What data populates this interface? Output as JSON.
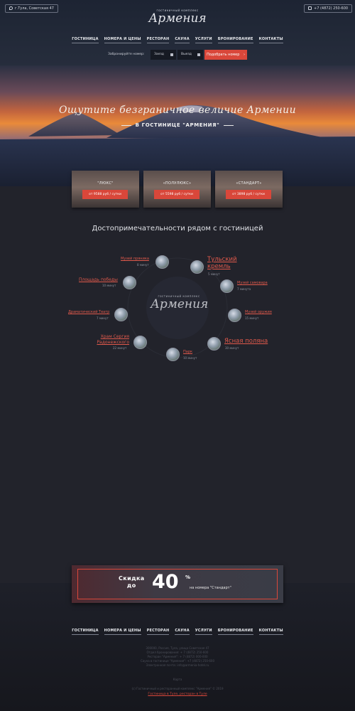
{
  "header": {
    "address": "г.Тула, Советская 47",
    "phone": "+7 (4872) 250-600",
    "logo_sub": "гостиничный комплекс",
    "logo_main": "Армения"
  },
  "nav": {
    "items": [
      "ГОСТИНИЦА",
      "НОМЕРА И ЦЕНЫ",
      "РЕСТОРАН",
      "САУНА",
      "УСЛУГИ",
      "БРОНИРОВАНИЕ",
      "КОНТАКТЫ"
    ]
  },
  "booking": {
    "label": "Забронируйте номер:",
    "checkin": "Заезд",
    "checkout": "Выезд",
    "button": "Подобрать номер"
  },
  "hero": {
    "title": "Ощутите безграничное величие Армении",
    "subtitle": "В ГОСТИНИЦЕ \"АРМЕНИЯ\""
  },
  "rooms": [
    {
      "title": "\"ЛЮКС\"",
      "price": "от 9588 руб / сутки"
    },
    {
      "title": "«ПОЛУЛЮКС»",
      "price": "от 5598 руб / сутки"
    },
    {
      "title": "«СТАНДАРТ»",
      "price": "от 3898 руб / сутки"
    }
  ],
  "attractions": {
    "title": "Достопримечательности рядом с гостиницей",
    "items": [
      {
        "name": "Музей пряника",
        "time": "8 минут"
      },
      {
        "name": "Тульский кремль",
        "time": "5 минут"
      },
      {
        "name": "Площадь победы",
        "time": "10 минут"
      },
      {
        "name": "Музей самовара",
        "time": "7 минута"
      },
      {
        "name": "Драматический Театр",
        "time": "7 минут"
      },
      {
        "name": "Музей оружия",
        "time": "15 минут"
      },
      {
        "name": "Храм Сергия Радонежского",
        "time": "22 минут"
      },
      {
        "name": "Ясная поляна",
        "time": "30 минут"
      },
      {
        "name": "Парк",
        "time": "10 минут"
      }
    ]
  },
  "promo": {
    "line1": "Скидка",
    "line2": "до",
    "number": "40",
    "percent": "%",
    "rest": "на номера \"Стандарт\""
  },
  "footer": {
    "lines": [
      "300000, Россия, Тула, улица Советская 47",
      "Отдел бронирования: + 7 (4872) 250-600",
      "Ресторан \"Армения\": + 7 (4872) 000-000",
      "Сауна в гостинице \"Армения\": +7 (4872) 250-600",
      "Электронная почта: info@armenia-hotel.ru"
    ],
    "map": "Карта",
    "copyright": "(c) Гостиничный и ресторанный комплекс \"Армения\" © 2019",
    "link": "Гостиница в Туле, ресторан в Туле"
  },
  "colors": {
    "accent": "#d9473a",
    "background": "#22232b"
  },
  "icons": [
    "map-pin-icon",
    "phone-icon",
    "calendar-icon",
    "chevron-right-icon"
  ]
}
